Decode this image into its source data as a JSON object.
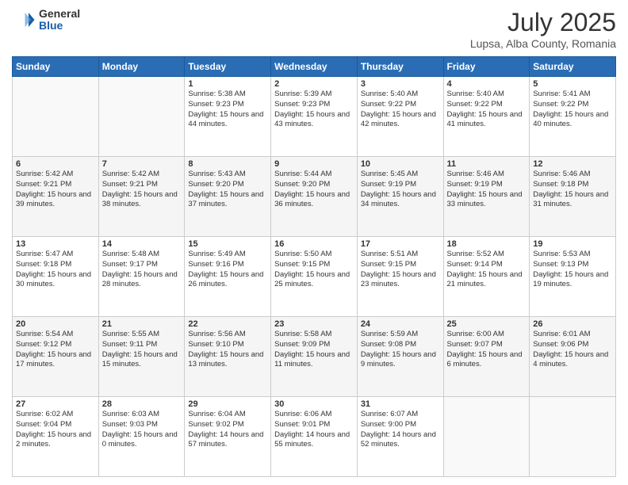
{
  "logo": {
    "general": "General",
    "blue": "Blue"
  },
  "title": "July 2025",
  "subtitle": "Lupsa, Alba County, Romania",
  "days_header": [
    "Sunday",
    "Monday",
    "Tuesday",
    "Wednesday",
    "Thursday",
    "Friday",
    "Saturday"
  ],
  "weeks": [
    [
      {
        "day": "",
        "info": ""
      },
      {
        "day": "",
        "info": ""
      },
      {
        "day": "1",
        "info": "Sunrise: 5:38 AM\nSunset: 9:23 PM\nDaylight: 15 hours and 44 minutes."
      },
      {
        "day": "2",
        "info": "Sunrise: 5:39 AM\nSunset: 9:23 PM\nDaylight: 15 hours and 43 minutes."
      },
      {
        "day": "3",
        "info": "Sunrise: 5:40 AM\nSunset: 9:22 PM\nDaylight: 15 hours and 42 minutes."
      },
      {
        "day": "4",
        "info": "Sunrise: 5:40 AM\nSunset: 9:22 PM\nDaylight: 15 hours and 41 minutes."
      },
      {
        "day": "5",
        "info": "Sunrise: 5:41 AM\nSunset: 9:22 PM\nDaylight: 15 hours and 40 minutes."
      }
    ],
    [
      {
        "day": "6",
        "info": "Sunrise: 5:42 AM\nSunset: 9:21 PM\nDaylight: 15 hours and 39 minutes."
      },
      {
        "day": "7",
        "info": "Sunrise: 5:42 AM\nSunset: 9:21 PM\nDaylight: 15 hours and 38 minutes."
      },
      {
        "day": "8",
        "info": "Sunrise: 5:43 AM\nSunset: 9:20 PM\nDaylight: 15 hours and 37 minutes."
      },
      {
        "day": "9",
        "info": "Sunrise: 5:44 AM\nSunset: 9:20 PM\nDaylight: 15 hours and 36 minutes."
      },
      {
        "day": "10",
        "info": "Sunrise: 5:45 AM\nSunset: 9:19 PM\nDaylight: 15 hours and 34 minutes."
      },
      {
        "day": "11",
        "info": "Sunrise: 5:46 AM\nSunset: 9:19 PM\nDaylight: 15 hours and 33 minutes."
      },
      {
        "day": "12",
        "info": "Sunrise: 5:46 AM\nSunset: 9:18 PM\nDaylight: 15 hours and 31 minutes."
      }
    ],
    [
      {
        "day": "13",
        "info": "Sunrise: 5:47 AM\nSunset: 9:18 PM\nDaylight: 15 hours and 30 minutes."
      },
      {
        "day": "14",
        "info": "Sunrise: 5:48 AM\nSunset: 9:17 PM\nDaylight: 15 hours and 28 minutes."
      },
      {
        "day": "15",
        "info": "Sunrise: 5:49 AM\nSunset: 9:16 PM\nDaylight: 15 hours and 26 minutes."
      },
      {
        "day": "16",
        "info": "Sunrise: 5:50 AM\nSunset: 9:15 PM\nDaylight: 15 hours and 25 minutes."
      },
      {
        "day": "17",
        "info": "Sunrise: 5:51 AM\nSunset: 9:15 PM\nDaylight: 15 hours and 23 minutes."
      },
      {
        "day": "18",
        "info": "Sunrise: 5:52 AM\nSunset: 9:14 PM\nDaylight: 15 hours and 21 minutes."
      },
      {
        "day": "19",
        "info": "Sunrise: 5:53 AM\nSunset: 9:13 PM\nDaylight: 15 hours and 19 minutes."
      }
    ],
    [
      {
        "day": "20",
        "info": "Sunrise: 5:54 AM\nSunset: 9:12 PM\nDaylight: 15 hours and 17 minutes."
      },
      {
        "day": "21",
        "info": "Sunrise: 5:55 AM\nSunset: 9:11 PM\nDaylight: 15 hours and 15 minutes."
      },
      {
        "day": "22",
        "info": "Sunrise: 5:56 AM\nSunset: 9:10 PM\nDaylight: 15 hours and 13 minutes."
      },
      {
        "day": "23",
        "info": "Sunrise: 5:58 AM\nSunset: 9:09 PM\nDaylight: 15 hours and 11 minutes."
      },
      {
        "day": "24",
        "info": "Sunrise: 5:59 AM\nSunset: 9:08 PM\nDaylight: 15 hours and 9 minutes."
      },
      {
        "day": "25",
        "info": "Sunrise: 6:00 AM\nSunset: 9:07 PM\nDaylight: 15 hours and 6 minutes."
      },
      {
        "day": "26",
        "info": "Sunrise: 6:01 AM\nSunset: 9:06 PM\nDaylight: 15 hours and 4 minutes."
      }
    ],
    [
      {
        "day": "27",
        "info": "Sunrise: 6:02 AM\nSunset: 9:04 PM\nDaylight: 15 hours and 2 minutes."
      },
      {
        "day": "28",
        "info": "Sunrise: 6:03 AM\nSunset: 9:03 PM\nDaylight: 15 hours and 0 minutes."
      },
      {
        "day": "29",
        "info": "Sunrise: 6:04 AM\nSunset: 9:02 PM\nDaylight: 14 hours and 57 minutes."
      },
      {
        "day": "30",
        "info": "Sunrise: 6:06 AM\nSunset: 9:01 PM\nDaylight: 14 hours and 55 minutes."
      },
      {
        "day": "31",
        "info": "Sunrise: 6:07 AM\nSunset: 9:00 PM\nDaylight: 14 hours and 52 minutes."
      },
      {
        "day": "",
        "info": ""
      },
      {
        "day": "",
        "info": ""
      }
    ]
  ]
}
